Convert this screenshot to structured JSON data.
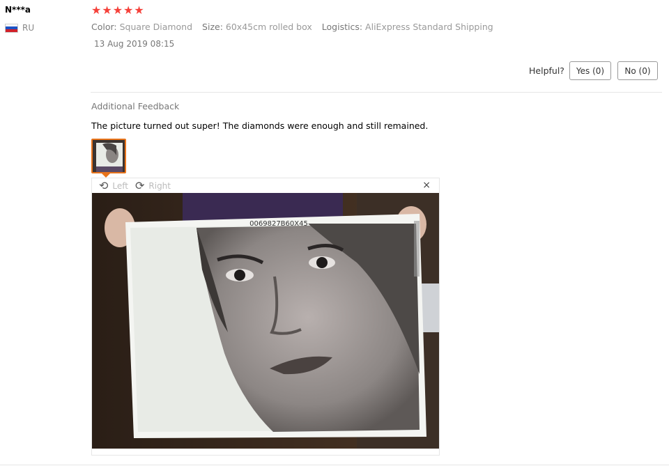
{
  "review": {
    "user_name": "N***a",
    "country": "RU",
    "rating_stars": 5,
    "attributes": [
      {
        "key": "Color:",
        "value": "Square Diamond"
      },
      {
        "key": "Size:",
        "value": "60x45cm rolled box"
      },
      {
        "key": "Logistics:",
        "value": "AliExpress Standard Shipping"
      }
    ],
    "date": "13 Aug 2019 08:15",
    "helpful_label": "Helpful?",
    "yes_label": "Yes (0)",
    "no_label": "No (0)"
  },
  "additional": {
    "title": "Additional Feedback",
    "text": "The picture turned out super! The diamonds were enough and still remained."
  },
  "viewer": {
    "rotate_left_label": "Left",
    "rotate_right_label": "Right",
    "close_symbol": "×",
    "photo_code": "0069827B60X45"
  },
  "colors": {
    "star": "#f5413a",
    "thumb_border": "#e8731a"
  }
}
